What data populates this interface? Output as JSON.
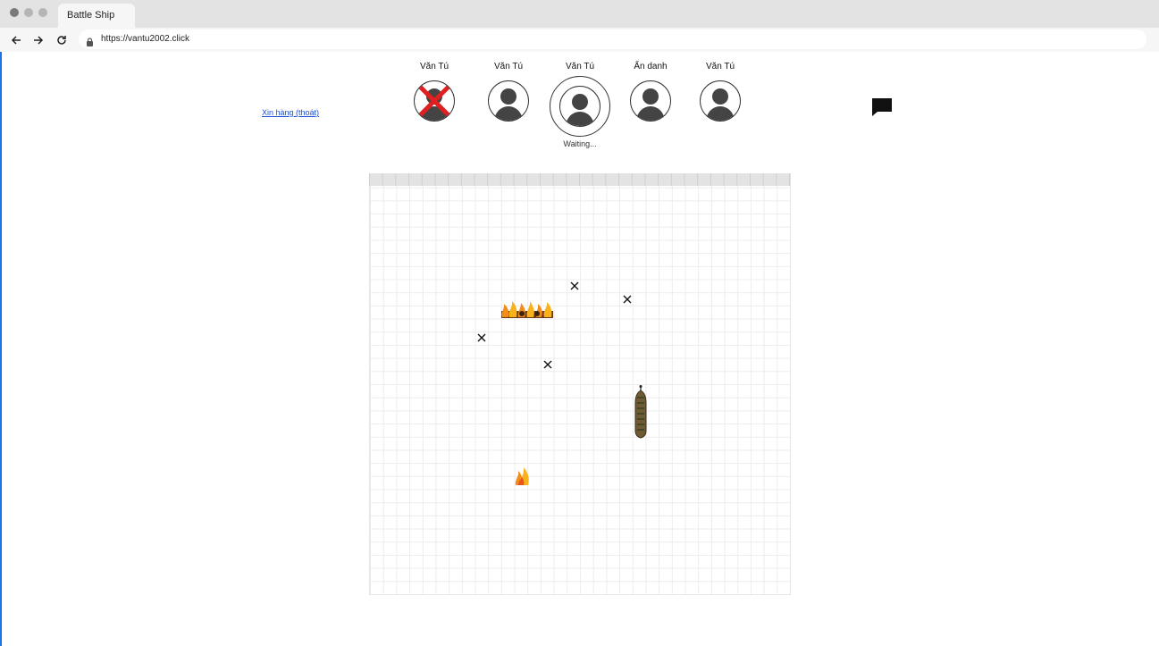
{
  "browser": {
    "tab_title": "Battle Ship",
    "url": "https://vantu2002.click"
  },
  "game": {
    "surrender_label": "Xin hàng (thoát)",
    "players": [
      {
        "name": "Văn Tú",
        "status": "eliminated"
      },
      {
        "name": "Văn Tú",
        "status": "alive"
      },
      {
        "name": "Văn Tú",
        "status": "current-turn",
        "note": "Waiting..."
      },
      {
        "name": "Ẩn danh",
        "status": "alive"
      },
      {
        "name": "Văn Tú",
        "status": "alive"
      }
    ],
    "board": {
      "hits_fire": [
        "burning ship segment row",
        "single fire"
      ],
      "misses": 4
    }
  },
  "icons": {
    "chat": "chat-bubble-icon",
    "avatar": "user-avatar-icon",
    "eliminated": "red-x-icon"
  },
  "colors": {
    "link": "#1a4fd6",
    "eliminated_x": "#e02020",
    "avatar": "#444444"
  }
}
